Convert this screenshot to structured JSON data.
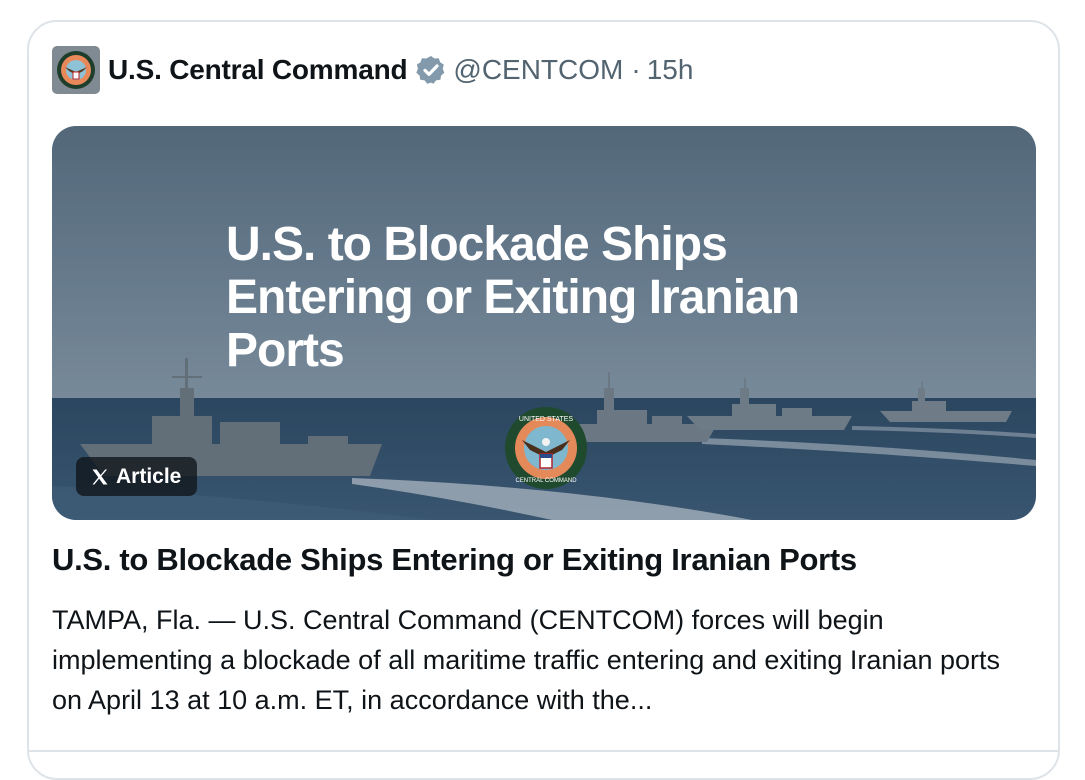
{
  "post": {
    "author_name": "U.S. Central Command",
    "handle": "@CENTCOM",
    "separator": "·",
    "timestamp": "15h",
    "verified_icon": "verified-badge-icon",
    "avatar_icon": "centcom-seal-icon"
  },
  "article": {
    "image_title": "U.S. to Blockade Ships Entering or Exiting Iranian Ports",
    "badge_label": "Article",
    "badge_icon": "x-logo-icon",
    "headline": "U.S. to Blockade Ships Entering or Exiting Iranian Ports",
    "summary": "TAMPA, Fla. — U.S. Central Command (CENTCOM) forces will begin implementing a blockade of all maritime traffic entering and exiting Iranian ports on April 13 at 10 a.m. ET, in accordance with the...",
    "emblem_text_top": "UNITED STATES",
    "emblem_text_bottom": "CENTRAL COMMAND"
  },
  "colors": {
    "text_primary": "#0f1419",
    "text_secondary": "#536471",
    "border": "#dde3e8",
    "verified": "#829aab"
  }
}
